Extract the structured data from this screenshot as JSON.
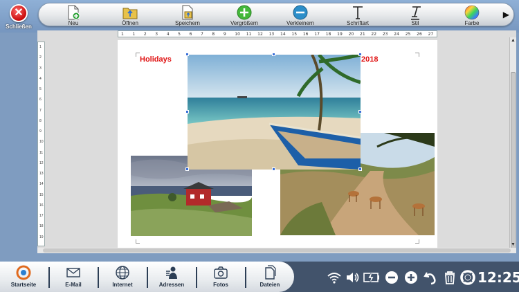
{
  "topbar": {
    "close_label": "Schließen",
    "tools": [
      {
        "label": "Neu",
        "icon": "new-document-icon"
      },
      {
        "label": "Öffnen",
        "icon": "open-folder-icon"
      },
      {
        "label": "Speichern",
        "icon": "save-icon"
      },
      {
        "label": "Vergrößern",
        "icon": "zoom-in-icon"
      },
      {
        "label": "Verkleinern",
        "icon": "zoom-out-icon"
      },
      {
        "label": "Schriftart",
        "icon": "font-icon"
      },
      {
        "label": "Stil",
        "icon": "italic-icon"
      },
      {
        "label": "Farbe",
        "icon": "color-wheel-icon"
      }
    ],
    "more_arrow": "▶"
  },
  "ruler": {
    "ticks": [
      "1",
      "1",
      "2",
      "3",
      "4",
      "5",
      "6",
      "7",
      "8",
      "9",
      "10",
      "11",
      "12",
      "13",
      "14",
      "15",
      "16",
      "17",
      "18",
      "19",
      "20",
      "21",
      "22",
      "23",
      "24",
      "25",
      "26",
      "27"
    ],
    "vticks": [
      "1",
      "2",
      "3",
      "4",
      "5",
      "6",
      "7",
      "8",
      "9",
      "10",
      "11",
      "12",
      "13",
      "14",
      "15",
      "16",
      "17",
      "18",
      "19"
    ]
  },
  "document": {
    "title_left": "Holidays",
    "title_right": "2018",
    "title_color": "#e01313"
  },
  "taskbar": {
    "apps": [
      {
        "label": "Startseite",
        "icon": "home-logo-icon"
      },
      {
        "label": "E-Mail",
        "icon": "mail-icon"
      },
      {
        "label": "Internet",
        "icon": "globe-icon"
      },
      {
        "label": "Adressen",
        "icon": "contacts-icon"
      },
      {
        "label": "Fotos",
        "icon": "camera-icon"
      },
      {
        "label": "Dateien",
        "icon": "files-icon"
      }
    ],
    "tray_icons": [
      "wifi-icon",
      "volume-icon",
      "battery-charging-icon",
      "zoom-out-icon",
      "zoom-in-icon",
      "undo-icon",
      "trash-icon",
      "help-lifebuoy-icon"
    ],
    "clock": "12:25"
  }
}
